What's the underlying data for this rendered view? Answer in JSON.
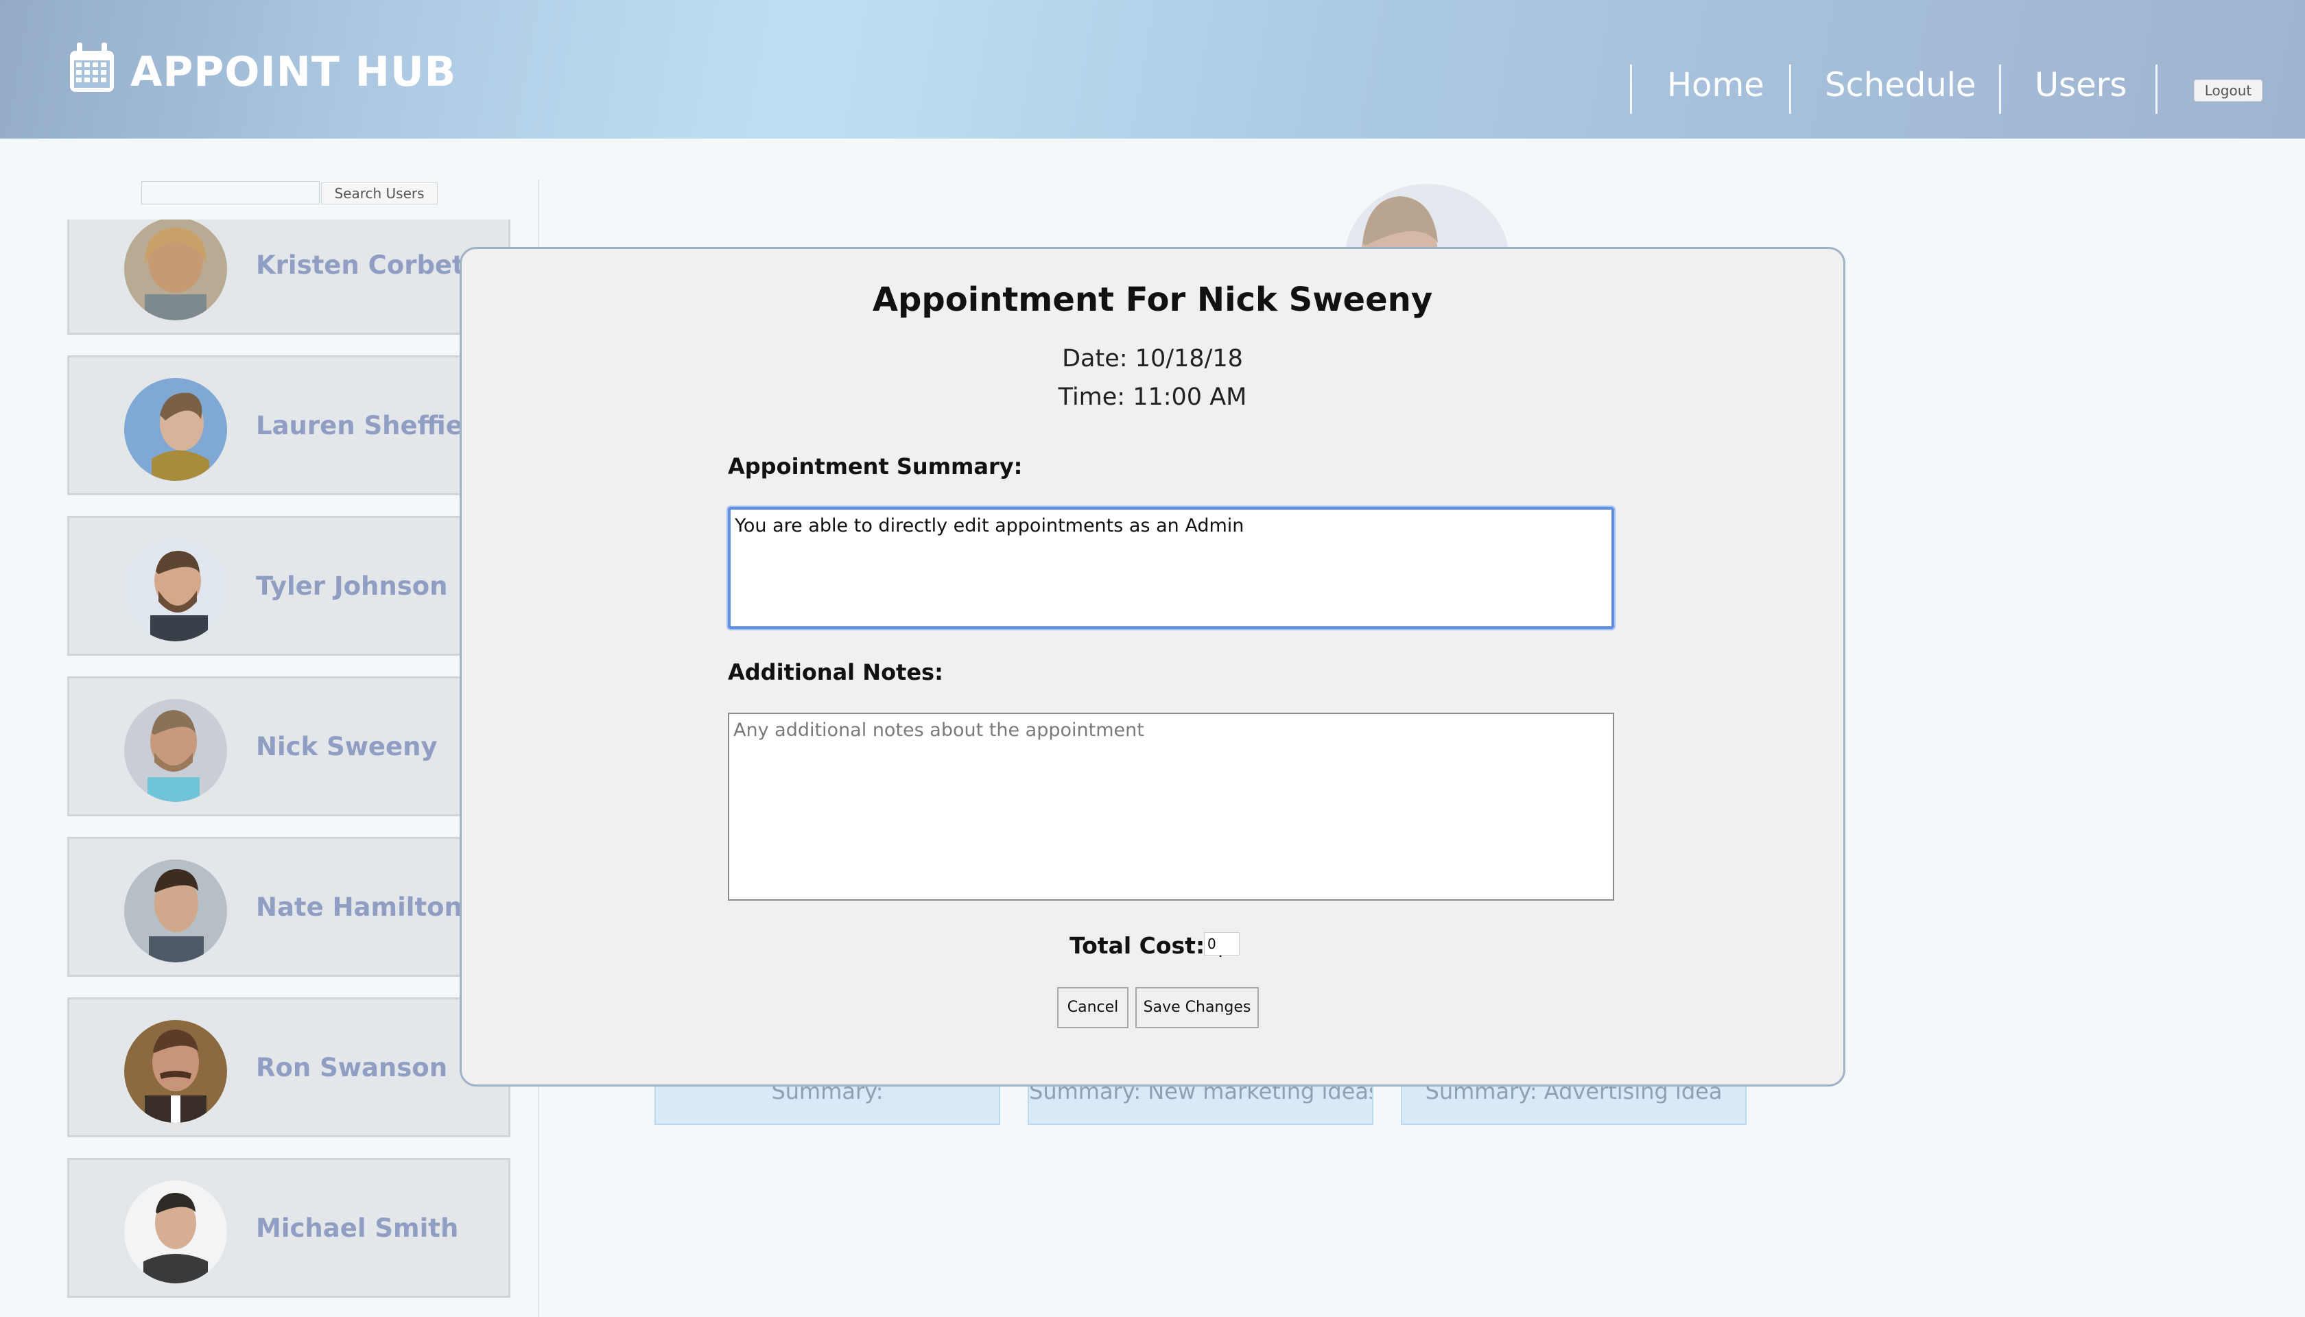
{
  "app": {
    "title": "APPOINT HUB",
    "brand_icon": "calendar-icon"
  },
  "nav": {
    "items": [
      {
        "label": "Home"
      },
      {
        "label": "Schedule"
      },
      {
        "label": "Users"
      }
    ],
    "logout_label": "Logout"
  },
  "sidebar": {
    "search_value": "",
    "search_button_label": "Search Users",
    "users": [
      {
        "name": "Kristen Corbett"
      },
      {
        "name": "Lauren Sheffield"
      },
      {
        "name": "Tyler Johnson"
      },
      {
        "name": "Nick Sweeny"
      },
      {
        "name": "Nate Hamilton"
      },
      {
        "name": "Ron Swanson"
      },
      {
        "name": "Michael Smith"
      }
    ]
  },
  "background": {
    "appointments": [
      {
        "summary": "Summary:"
      },
      {
        "summary": "Summary: New marketing ideas"
      },
      {
        "summary": "Summary: Advertising idea"
      }
    ]
  },
  "modal": {
    "title": "Appointment For Nick Sweeny",
    "date": "Date: 10/18/18",
    "time": "Time: 11:00 AM",
    "summary_label": "Appointment Summary:",
    "summary_value": "You are able to directly edit appointments as an Admin",
    "notes_label": "Additional Notes:",
    "notes_value": "",
    "notes_placeholder": "Any additional notes about the appointment",
    "cost_label": "Total Cost: $",
    "cost_value": "0",
    "cancel_label": "Cancel",
    "save_label": "Save Changes"
  },
  "colors": {
    "accent_focus": "#5f8fe0",
    "user_name": "#8f9ec2",
    "header_white": "#ffffff"
  }
}
